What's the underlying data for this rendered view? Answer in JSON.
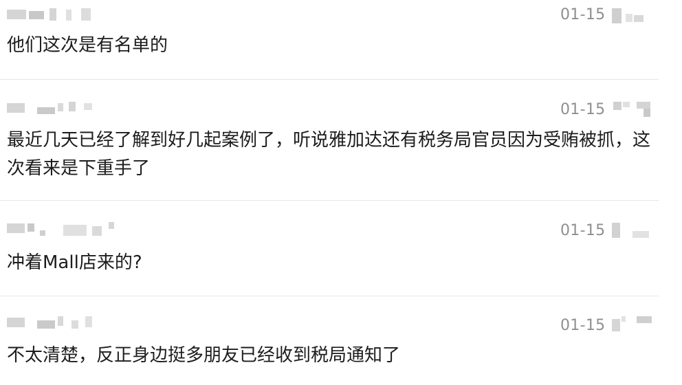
{
  "comments": [
    {
      "date": "01-15",
      "text": "他们这次是有名单的"
    },
    {
      "date": "01-15",
      "text": "最近几天已经了解到好几起案例了，听说雅加达还有税务局官员因为受贿被抓，这次看来是下重手了"
    },
    {
      "date": "01-15",
      "text": "冲着Mall店来的?"
    },
    {
      "date": "01-15",
      "text": "不太清楚，反正身边挺多朋友已经收到税局通知了"
    }
  ],
  "colors": {
    "background": "#ffffff",
    "text": "#1c1c1c",
    "date": "#8f8f8f",
    "divider": "#e6e6e6",
    "blur": "#d5d5d5"
  }
}
